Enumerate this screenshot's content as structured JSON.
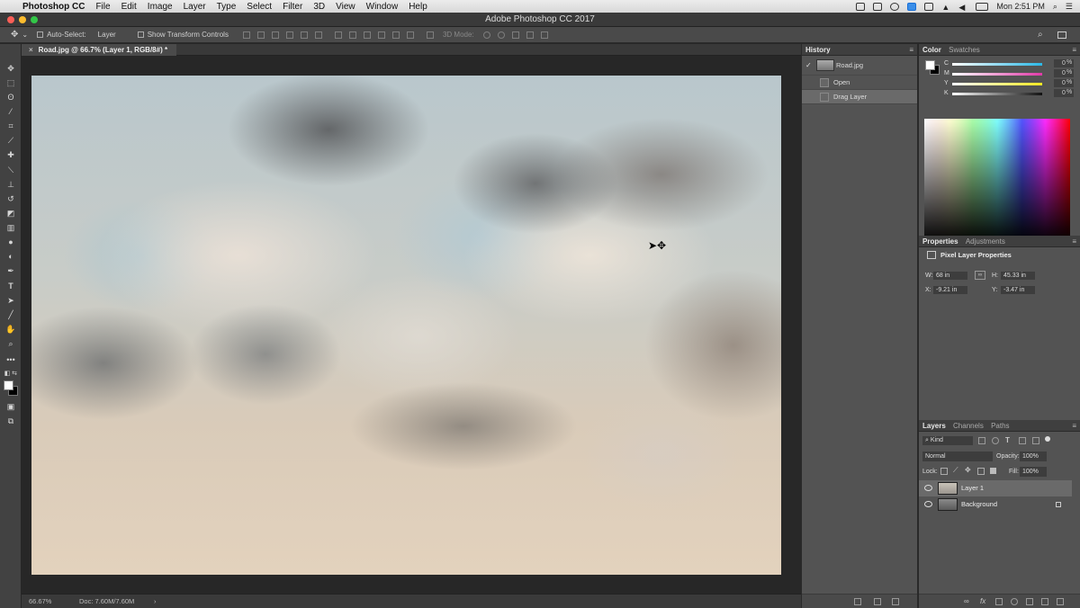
{
  "menubar": {
    "app": "Photoshop CC",
    "items": [
      "File",
      "Edit",
      "Image",
      "Layer",
      "Type",
      "Select",
      "Filter",
      "3D",
      "View",
      "Window",
      "Help"
    ],
    "clock": "Mon 2:51 PM"
  },
  "window": {
    "title": "Adobe Photoshop CC 2017"
  },
  "options": {
    "auto_select_label": "Auto-Select:",
    "auto_select_value": "Layer",
    "transform_label": "Show Transform Controls",
    "mode3d_label": "3D Mode:"
  },
  "document": {
    "tab": "Road.jpg @ 66.7% (Layer 1, RGB/8#) *"
  },
  "status": {
    "zoom": "66.67%",
    "doc": "Doc: 7.60M/7.60M"
  },
  "history": {
    "title": "History",
    "snapshot": "Road.jpg",
    "states": [
      "Open",
      "Drag Layer"
    ]
  },
  "color": {
    "tab_active": "Color",
    "tab_other": "Swatches",
    "sliders": [
      {
        "label": "C",
        "value": "0",
        "color": "#2bb8e6"
      },
      {
        "label": "M",
        "value": "0",
        "color": "#e03aa8"
      },
      {
        "label": "Y",
        "value": "0",
        "color": "#f2e822"
      },
      {
        "label": "K",
        "value": "0",
        "color": "#111111"
      }
    ],
    "percent": "%"
  },
  "properties": {
    "tab_active": "Properties",
    "tab_other": "Adjustments",
    "heading": "Pixel Layer Properties",
    "w_label": "W:",
    "w_value": "68 in",
    "h_label": "H:",
    "h_value": "45.33 in",
    "x_label": "X:",
    "x_value": "-9.21 in",
    "y_label": "Y:",
    "y_value": "-3.47 in"
  },
  "layers": {
    "tabs": [
      "Layers",
      "Channels",
      "Paths"
    ],
    "filter": "Kind",
    "blend_mode": "Normal",
    "opacity_label": "Opacity:",
    "opacity_value": "100%",
    "lock_label": "Lock:",
    "fill_label": "Fill:",
    "fill_value": "100%",
    "items": [
      {
        "name": "Layer 1",
        "selected": true
      },
      {
        "name": "Background",
        "selected": false
      }
    ]
  }
}
